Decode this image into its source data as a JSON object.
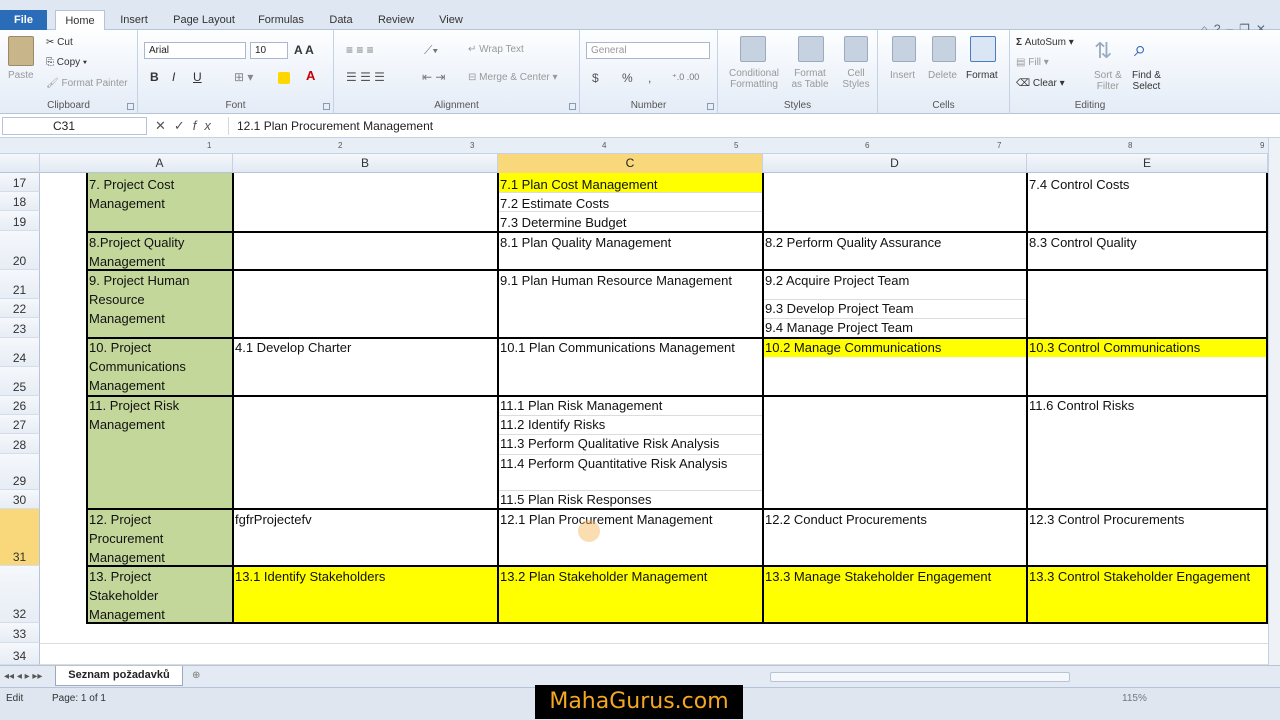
{
  "ribbon_tabs": [
    "File",
    "Home",
    "Insert",
    "Page Layout",
    "Formulas",
    "Data",
    "Review",
    "View"
  ],
  "clipboard": {
    "paste": "Paste",
    "cut": "Cut",
    "copy": "Copy",
    "format_painter": "Format Painter",
    "group": "Clipboard"
  },
  "font": {
    "name": "Arial",
    "size": "10",
    "bold": "B",
    "italic": "I",
    "underline": "U",
    "group": "Font"
  },
  "alignment": {
    "wrap": "Wrap Text",
    "merge": "Merge & Center",
    "group": "Alignment"
  },
  "number": {
    "format": "General",
    "currency": "$",
    "percent": "%",
    "comma": ",",
    "group": "Number"
  },
  "styles": {
    "cond": "Conditional",
    "cond2": "Formatting",
    "table": "Format",
    "table2": "as Table",
    "cell": "Cell",
    "cell2": "Styles",
    "group": "Styles"
  },
  "cells": {
    "insert": "Insert",
    "delete": "Delete",
    "format": "Format",
    "group": "Cells"
  },
  "editing": {
    "autosum": "AutoSum",
    "fill": "Fill",
    "clear": "Clear",
    "sort": "Sort &",
    "sort2": "Filter",
    "find": "Find &",
    "find2": "Select",
    "group": "Editing"
  },
  "formula_bar": {
    "name_box": "C31",
    "formula": "12.1 Plan Procurement Management"
  },
  "columns": [
    "A",
    "B",
    "C",
    "D",
    "E"
  ],
  "rows": [
    "17",
    "18",
    "19",
    "20",
    "21",
    "22",
    "23",
    "24",
    "25",
    "26",
    "27",
    "28",
    "29",
    "30",
    "31",
    "32",
    "33",
    "34"
  ],
  "cells_data": {
    "a17": "7. Project Cost",
    "a17b": "Management",
    "c17": "7.1 Plan Cost Management",
    "c18": "7.2 Estimate Costs",
    "c19": "7.3 Determine Budget",
    "e17": "7.4 Control Costs",
    "a20": "8.Project Quality",
    "a20b": "Management",
    "c20": "8.1 Plan Quality Management",
    "d20": "8.2 Perform Quality Assurance",
    "e20": "8.3 Control Quality",
    "a21": "9. Project Human",
    "a21b": "Resource",
    "a21c": "Management",
    "c21": "9.1 Plan Human Resource Management",
    "d21": "9.2 Acquire Project Team",
    "d22": "9.3 Develop Project Team",
    "d23": "9.4 Manage Project Team",
    "a24": "10. Project",
    "a24b": "Communications",
    "a24c": "Management",
    "b24": "4.1 Develop  Charter",
    "c24": "10.1 Plan Communications Management",
    "d24": "10.2 Manage Communications",
    "e24": "10.3 Control Communications",
    "a26": "11. Project Risk",
    "a26b": "Management",
    "c26": "11.1 Plan Risk Management",
    "c27": "11.2 Identify Risks",
    "c28": "11.3 Perform Qualitative Risk Analysis",
    "c29": "11.4 Perform Quantitative Risk Analysis",
    "c30": "11.5 Plan Risk Responses",
    "e26": "11.6 Control Risks",
    "a31": "12. Project",
    "a31b": "Procurement",
    "a31c": "Management",
    "b31": "fgfrProjectefv",
    "c31": "12.1 Plan Procurement Management",
    "d31": "12.2 Conduct Procurements",
    "e31": "12.3 Control Procurements",
    "a32": "13. Project",
    "a32b": "Stakeholder",
    "a32c": "Management",
    "b32": "13.1 Identify Stakeholders",
    "c32": "13.2 Plan Stakeholder Management",
    "d32": "13.3 Manage Stakeholder Engagement",
    "e32": "13.3 Control Stakeholder Engagement"
  },
  "sheet_tab": "Seznam požadavků",
  "status": {
    "mode": "Edit",
    "page": "Page: 1 of 1",
    "zoom": "115%"
  },
  "watermark": "MahaGurus.com",
  "colors": {
    "green": "#c4d79b",
    "yellow": "#ffff00",
    "selected_header": "#f9d87c"
  }
}
